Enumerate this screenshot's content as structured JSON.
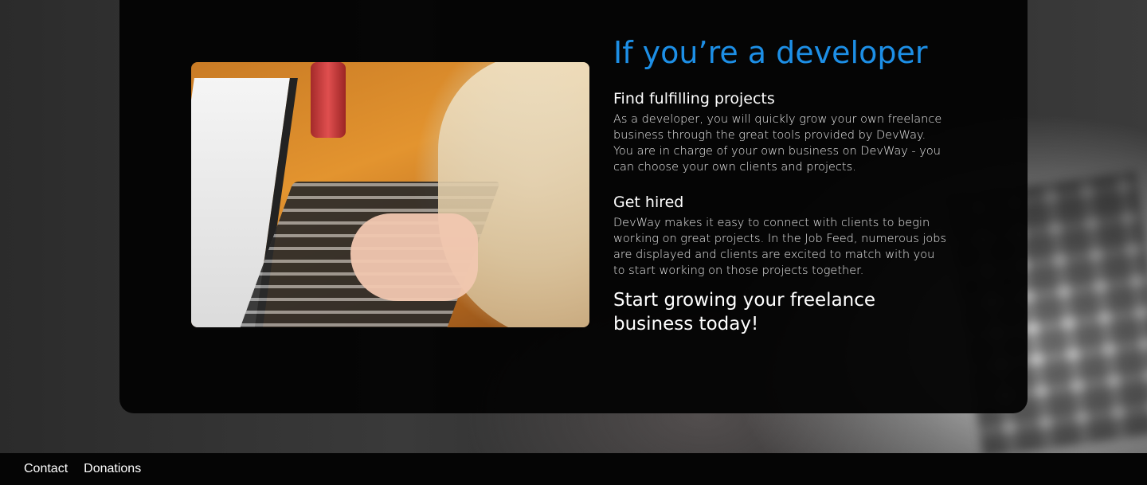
{
  "section": {
    "headline": "If you’re a developer",
    "blocks": [
      {
        "title": "Find fulfilling projects",
        "text": "As a developer, you will quickly grow your own freelance business through the great tools provided by DevWay. You are in charge of your own business on DevWay - you can choose your own clients and projects."
      },
      {
        "title": "Get hired",
        "text": "DevWay makes it easy to connect with clients to begin working on great projects. In the Job Feed, numerous jobs are displayed and clients are excited to match with you to start working on those projects together."
      }
    ],
    "cta": "Start growing your freelance business today!",
    "image_icon": "developer-laptop-photo"
  },
  "footer": {
    "links": [
      "Contact",
      "Donations"
    ]
  },
  "colors": {
    "headline": "#1d8fe6",
    "card_background": "#040404",
    "footer_background": "#050505",
    "text": "#ffffff"
  }
}
